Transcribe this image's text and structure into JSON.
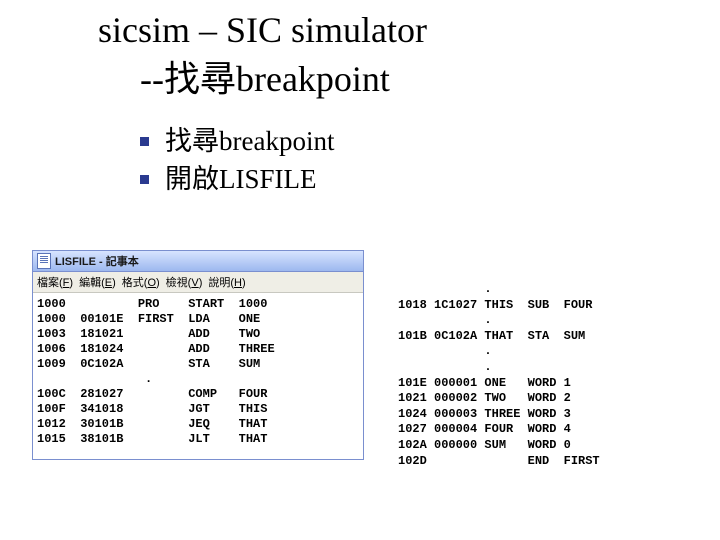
{
  "title": "sicsim – SIC simulator",
  "subtitle": "--找尋breakpoint",
  "bullets": [
    "找尋breakpoint",
    "開啟LISFILE"
  ],
  "notepad": {
    "title": "LISFILE - 記事本",
    "menu": [
      {
        "label": "檔案",
        "key": "F"
      },
      {
        "label": "編輯",
        "key": "E"
      },
      {
        "label": "格式",
        "key": "O"
      },
      {
        "label": "檢視",
        "key": "V"
      },
      {
        "label": "說明",
        "key": "H"
      }
    ],
    "rows": [
      {
        "addr": "1000",
        "obj": "      ",
        "lbl": "PRO  ",
        "op": "START",
        "opr": "1000 "
      },
      {
        "addr": "1000",
        "obj": "00101E",
        "lbl": "FIRST",
        "op": "LDA  ",
        "opr": "ONE  "
      },
      {
        "addr": "1003",
        "obj": "181021",
        "lbl": "     ",
        "op": "ADD  ",
        "opr": "TWO  "
      },
      {
        "addr": "1006",
        "obj": "181024",
        "lbl": "     ",
        "op": "ADD  ",
        "opr": "THREE"
      },
      {
        "addr": "1009",
        "obj": "0C102A",
        "lbl": "     ",
        "op": "STA  ",
        "opr": "SUM  "
      },
      {
        "addr": "    ",
        "obj": "      ",
        "lbl": " .   ",
        "op": "     ",
        "opr": "     "
      },
      {
        "addr": "100C",
        "obj": "281027",
        "lbl": "     ",
        "op": "COMP ",
        "opr": "FOUR "
      },
      {
        "addr": "100F",
        "obj": "341018",
        "lbl": "     ",
        "op": "JGT  ",
        "opr": "THIS "
      },
      {
        "addr": "1012",
        "obj": "30101B",
        "lbl": "     ",
        "op": "JEQ  ",
        "opr": "THAT "
      },
      {
        "addr": "1015",
        "obj": "38101B",
        "lbl": "     ",
        "op": "JLT  ",
        "opr": "THAT "
      }
    ]
  },
  "listing2": {
    "rows": [
      {
        "addr": "    ",
        "obj": "      ",
        "lbl": ".    ",
        "op": "    ",
        "opr": "     "
      },
      {
        "addr": "1018",
        "obj": "1C1027",
        "lbl": "THIS ",
        "op": "SUB ",
        "opr": "FOUR "
      },
      {
        "addr": "    ",
        "obj": "      ",
        "lbl": ".    ",
        "op": "    ",
        "opr": "     "
      },
      {
        "addr": "101B",
        "obj": "0C102A",
        "lbl": "THAT ",
        "op": "STA ",
        "opr": "SUM  "
      },
      {
        "addr": "    ",
        "obj": "      ",
        "lbl": ".    ",
        "op": "    ",
        "opr": "     "
      },
      {
        "addr": "    ",
        "obj": "      ",
        "lbl": ".    ",
        "op": "    ",
        "opr": "     "
      },
      {
        "addr": "101E",
        "obj": "000001",
        "lbl": "ONE  ",
        "op": "WORD",
        "opr": "1    "
      },
      {
        "addr": "1021",
        "obj": "000002",
        "lbl": "TWO  ",
        "op": "WORD",
        "opr": "2    "
      },
      {
        "addr": "1024",
        "obj": "000003",
        "lbl": "THREE",
        "op": "WORD",
        "opr": "3    "
      },
      {
        "addr": "1027",
        "obj": "000004",
        "lbl": "FOUR ",
        "op": "WORD",
        "opr": "4    "
      },
      {
        "addr": "102A",
        "obj": "000000",
        "lbl": "SUM  ",
        "op": "WORD",
        "opr": "0    "
      },
      {
        "addr": "102D",
        "obj": "      ",
        "lbl": "     ",
        "op": "END ",
        "opr": "FIRST"
      }
    ]
  }
}
